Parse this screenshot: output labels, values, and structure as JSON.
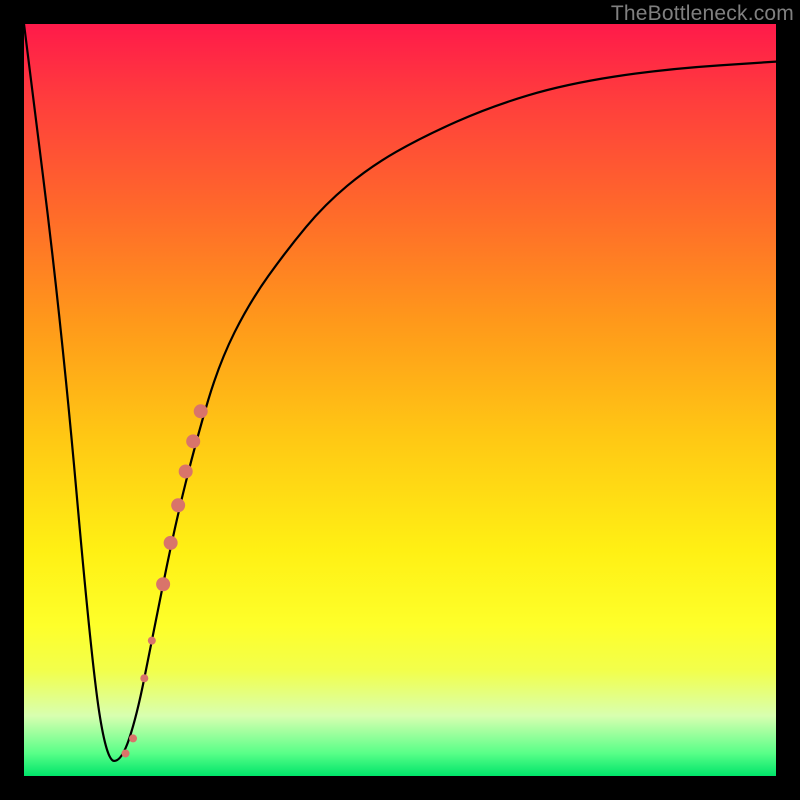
{
  "watermark": "TheBottleneck.com",
  "colors": {
    "frame": "#000000",
    "curve": "#000000",
    "marker": "#d9746a",
    "gradient_top": "#ff1a4a",
    "gradient_bottom": "#00e46a"
  },
  "chart_data": {
    "type": "line",
    "title": "",
    "xlabel": "",
    "ylabel": "",
    "xlim": [
      0,
      100
    ],
    "ylim": [
      0,
      100
    ],
    "grid": false,
    "legend": false,
    "series": [
      {
        "name": "bottleneck-curve",
        "x": [
          0,
          5,
          9,
          11,
          13,
          15,
          17,
          20,
          23,
          26,
          30,
          35,
          40,
          46,
          53,
          62,
          72,
          85,
          100
        ],
        "y": [
          100,
          60,
          15,
          2,
          2,
          8,
          18,
          33,
          45,
          55,
          63,
          70,
          76,
          81,
          85,
          89,
          92,
          94,
          95
        ]
      }
    ],
    "markers": [
      {
        "x": 13.5,
        "y": 3,
        "r": 4
      },
      {
        "x": 14.5,
        "y": 5,
        "r": 4
      },
      {
        "x": 16.0,
        "y": 13,
        "r": 4
      },
      {
        "x": 17.0,
        "y": 18,
        "r": 4
      },
      {
        "x": 18.5,
        "y": 25.5,
        "r": 7
      },
      {
        "x": 19.5,
        "y": 31,
        "r": 7
      },
      {
        "x": 20.5,
        "y": 36,
        "r": 7
      },
      {
        "x": 21.5,
        "y": 40.5,
        "r": 7
      },
      {
        "x": 22.5,
        "y": 44.5,
        "r": 7
      },
      {
        "x": 23.5,
        "y": 48.5,
        "r": 7
      }
    ]
  }
}
